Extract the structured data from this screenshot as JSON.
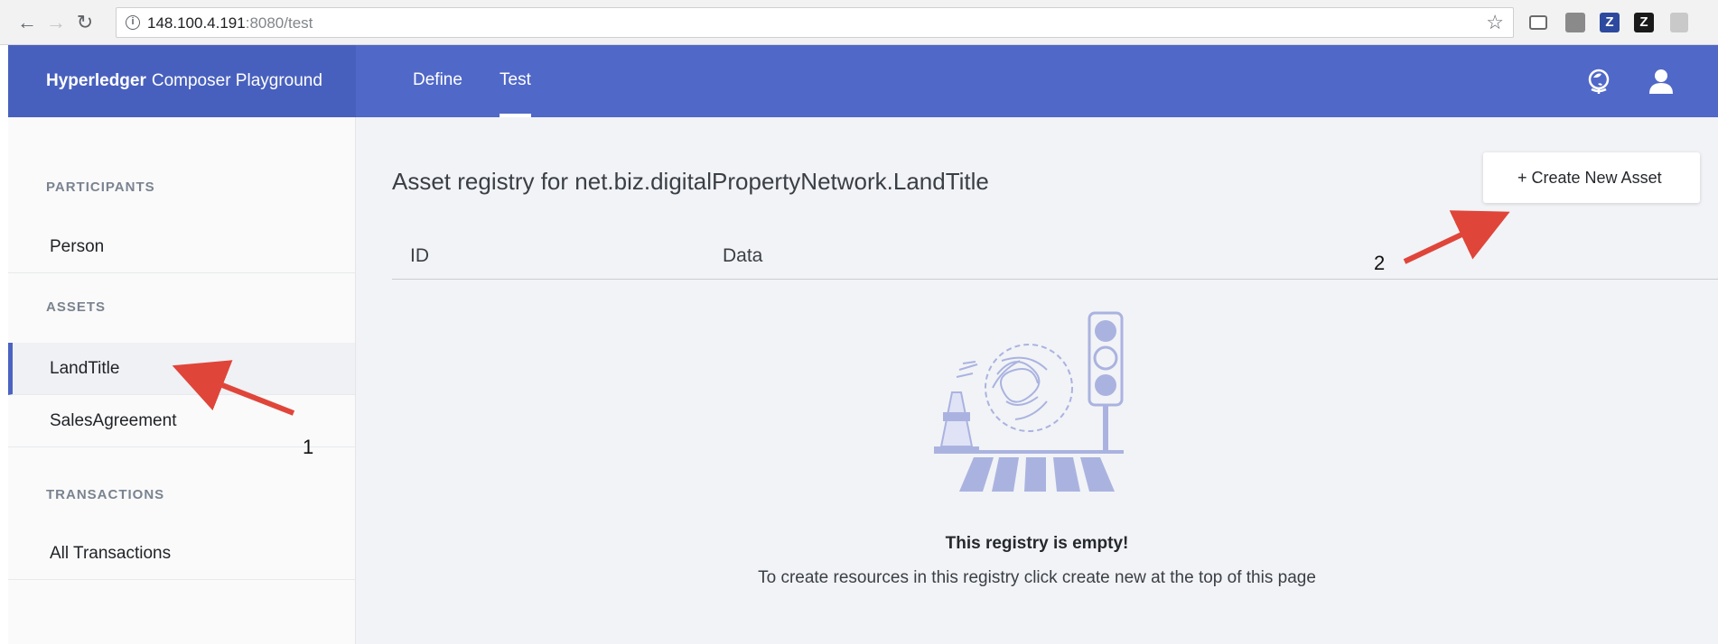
{
  "browser": {
    "url_host": "148.100.4.191",
    "url_rest": ":8080/test"
  },
  "app": {
    "brand_bold": "Hyperledger",
    "brand_rest": "Composer Playground",
    "tabs": [
      {
        "label": "Define",
        "active": false
      },
      {
        "label": "Test",
        "active": true
      }
    ]
  },
  "sidebar": {
    "participants_label": "PARTICIPANTS",
    "participants": [
      {
        "label": "Person"
      }
    ],
    "assets_label": "ASSETS",
    "assets": [
      {
        "label": "LandTitle",
        "selected": true
      },
      {
        "label": "SalesAgreement",
        "selected": false
      }
    ],
    "transactions_label": "TRANSACTIONS",
    "transactions": [
      {
        "label": "All Transactions"
      }
    ]
  },
  "main": {
    "title": "Asset registry for net.biz.digitalPropertyNetwork.LandTitle",
    "create_button": "+ Create New Asset",
    "columns": [
      "ID",
      "Data"
    ],
    "empty_title": "This registry is empty!",
    "empty_subtitle": "To create resources in this registry click create new at the top of this page"
  },
  "annotations": {
    "label_1": "1",
    "label_2": "2",
    "arrow_color": "#e0453a"
  },
  "colors": {
    "header": "#5068c7",
    "brand_bg": "#4860bd",
    "accent": "#4b63c1"
  }
}
